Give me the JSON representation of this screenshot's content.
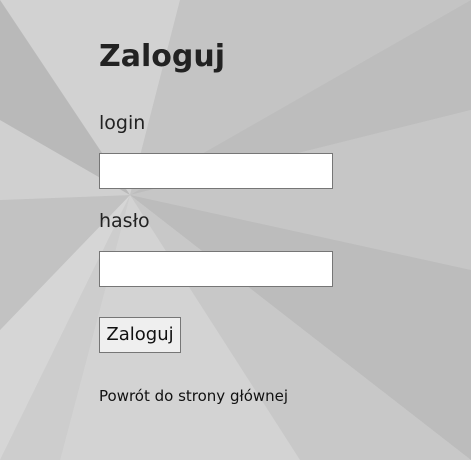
{
  "login_form": {
    "title": "Zaloguj",
    "login_label": "login",
    "login_value": "",
    "password_label": "hasło",
    "password_value": "",
    "submit_label": "Zaloguj"
  },
  "footer": {
    "back_link": "Powrót do strony głównej"
  },
  "colors": {
    "background": "#c8c8c8",
    "text": "#222222",
    "field_border": "#767676"
  }
}
